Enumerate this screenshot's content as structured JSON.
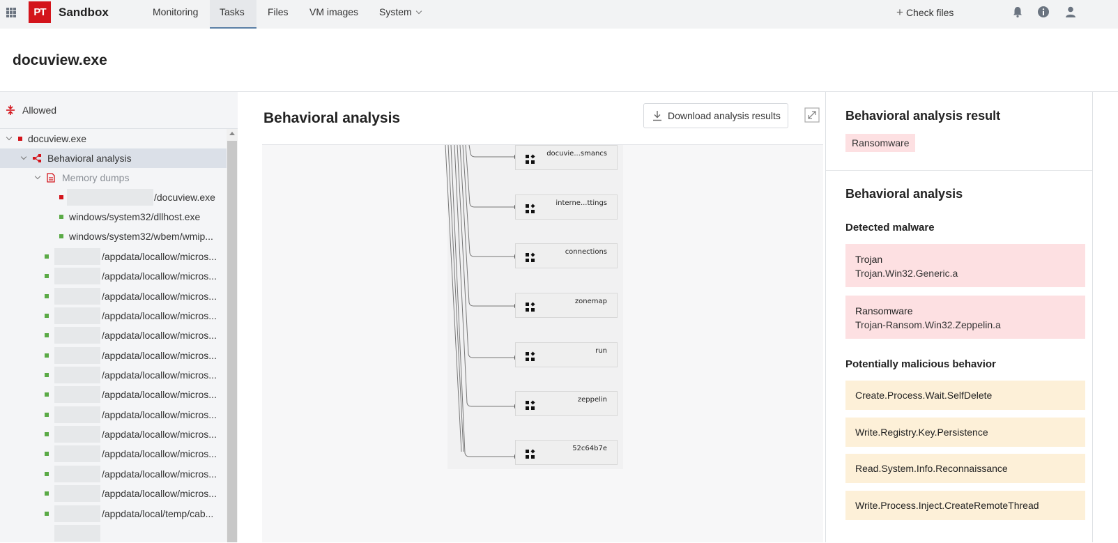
{
  "topbar": {
    "logo_text": "PT",
    "app_title": "Sandbox",
    "tabs": [
      {
        "label": "Monitoring"
      },
      {
        "label": "Tasks"
      },
      {
        "label": "Files"
      },
      {
        "label": "VM images"
      },
      {
        "label": "System"
      }
    ],
    "active_tab": "Tasks",
    "check_files_label": "Check files"
  },
  "page": {
    "title": "docuview.exe"
  },
  "sidebar": {
    "allowed_label": "Allowed",
    "tree": [
      {
        "text": "docuview.exe"
      },
      {
        "text": "Behavioral analysis"
      },
      {
        "text": "Memory dumps"
      },
      {
        "text": "/docuview.exe"
      },
      {
        "text": "windows/system32/dllhost.exe"
      },
      {
        "text": "windows/system32/wbem/wmip..."
      },
      {
        "text": "/appdata/locallow/micros..."
      },
      {
        "text": "/appdata/locallow/micros..."
      },
      {
        "text": "/appdata/locallow/micros..."
      },
      {
        "text": "/appdata/locallow/micros..."
      },
      {
        "text": "/appdata/locallow/micros..."
      },
      {
        "text": "/appdata/locallow/micros..."
      },
      {
        "text": "/appdata/locallow/micros..."
      },
      {
        "text": "/appdata/locallow/micros..."
      },
      {
        "text": "/appdata/locallow/micros..."
      },
      {
        "text": "/appdata/locallow/micros..."
      },
      {
        "text": "/appdata/locallow/micros..."
      },
      {
        "text": "/appdata/locallow/micros..."
      },
      {
        "text": "/appdata/locallow/micros..."
      },
      {
        "text": "/appdata/local/temp/cab..."
      }
    ]
  },
  "center": {
    "title": "Behavioral analysis",
    "download_label": "Download analysis results",
    "nodes": [
      {
        "label": "docuvie...smancs"
      },
      {
        "label": "interne...ttings"
      },
      {
        "label": "connections"
      },
      {
        "label": "zonemap"
      },
      {
        "label": "run"
      },
      {
        "label": "zeppelin"
      },
      {
        "label": "52c64b7e"
      }
    ]
  },
  "right": {
    "result_heading": "Behavioral analysis result",
    "result_tag": "Ransomware",
    "analysis_heading": "Behavioral analysis",
    "detected_heading": "Detected malware",
    "malware": [
      {
        "type": "Trojan",
        "name": "Trojan.Win32.Generic.a"
      },
      {
        "type": "Ransomware",
        "name": "Trojan-Ransom.Win32.Zeppelin.a"
      }
    ],
    "behavior_heading": "Potentially malicious behavior",
    "behaviors": [
      {
        "label": "Create.Process.Wait.SelfDelete"
      },
      {
        "label": "Write.Registry.Key.Persistence"
      },
      {
        "label": "Read.System.Info.Reconnaissance"
      },
      {
        "label": "Write.Process.Inject.CreateRemoteThread"
      }
    ]
  },
  "colors": {
    "brand_red": "#d3141b",
    "malware_card": "#fde0e2",
    "behavior_card": "#fdf0d8",
    "ok_green": "#5aaa46"
  }
}
